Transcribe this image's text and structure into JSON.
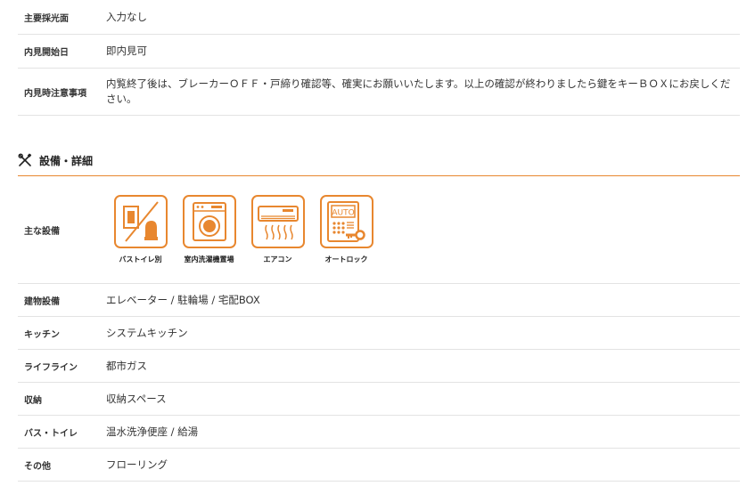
{
  "rows_top": [
    {
      "label": "主要採光面",
      "value": "入力なし"
    },
    {
      "label": "内見開始日",
      "value": "即内見可"
    },
    {
      "label": "内見時注意事項",
      "value": "内覧終了後は、ブレーカーＯＦＦ・戸締り確認等、確実にお願いいたします。以上の確認が終わりましたら鍵をキーＢＯＸにお戻しください。"
    }
  ],
  "section": {
    "title": "設備・詳細",
    "icon": "tools-icon"
  },
  "main_equipment": {
    "label": "主な設備",
    "icons": [
      {
        "caption": "バストイレ別",
        "icon": "bath-toilet-separate-icon"
      },
      {
        "caption": "室内洗濯機置場",
        "icon": "washing-machine-icon"
      },
      {
        "caption": "エアコン",
        "icon": "air-conditioner-icon"
      },
      {
        "caption": "オートロック",
        "icon": "auto-lock-icon",
        "badge": "AUTO"
      }
    ]
  },
  "rows_bottom": [
    {
      "label": "建物設備",
      "value": "エレベーター / 駐輪場 / 宅配BOX"
    },
    {
      "label": "キッチン",
      "value": "システムキッチン"
    },
    {
      "label": "ライフライン",
      "value": "都市ガス"
    },
    {
      "label": "収納",
      "value": "収納スペース"
    },
    {
      "label": "バス・トイレ",
      "value": "温水洗浄便座 / 給湯"
    },
    {
      "label": "その他",
      "value": "フローリング"
    }
  ],
  "colors": {
    "accent": "#e8872f",
    "divider": "#e3e3e3",
    "text": "#333333"
  }
}
